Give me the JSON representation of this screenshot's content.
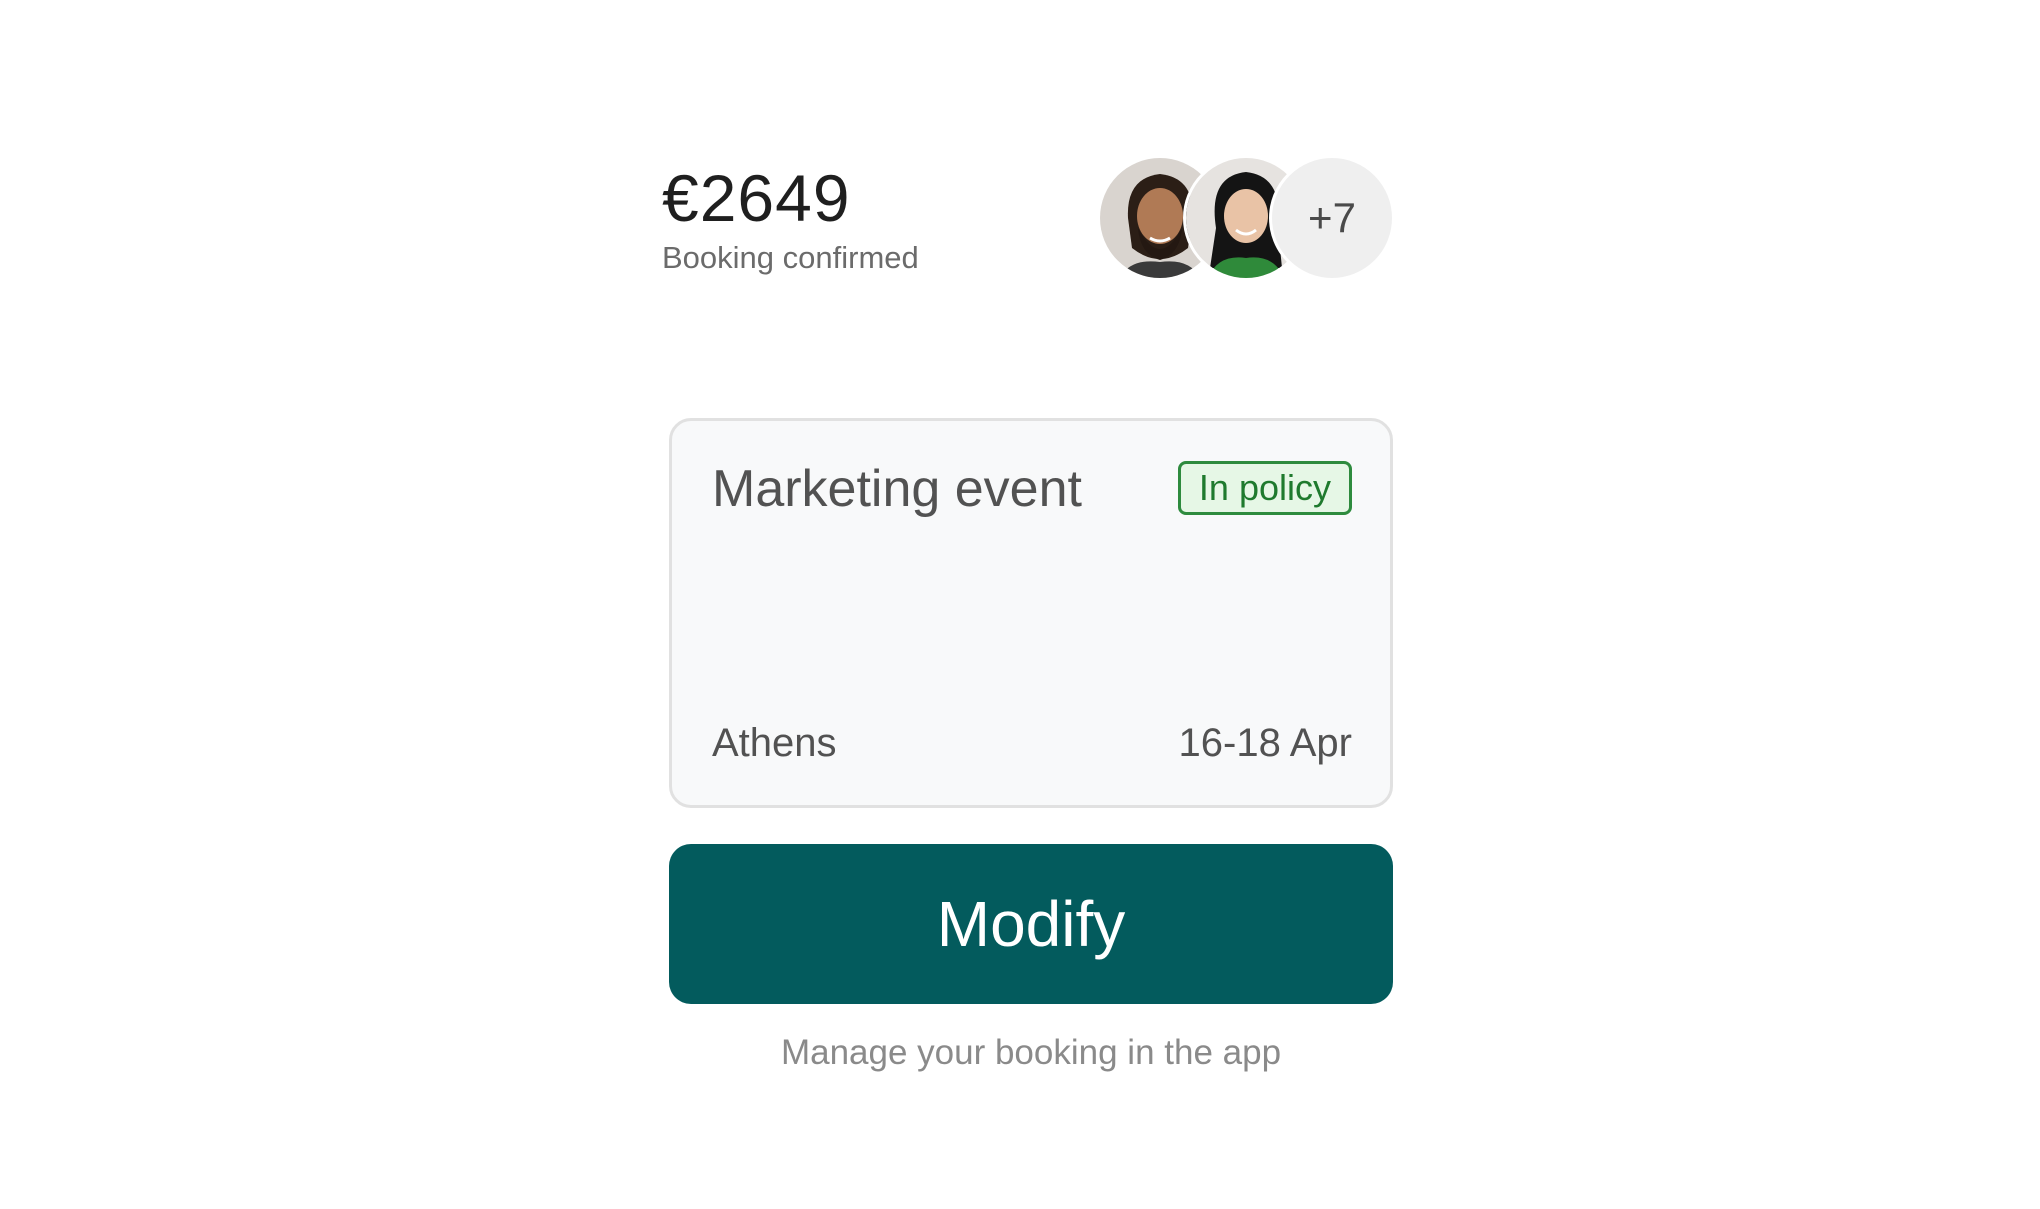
{
  "booking": {
    "price": "€2649",
    "status": "Booking confirmed"
  },
  "travelers": {
    "avatars": [
      {
        "name": "traveler-avatar-1",
        "icon": "person-photo"
      },
      {
        "name": "traveler-avatar-2",
        "icon": "person-photo"
      }
    ],
    "more_count": "+7"
  },
  "event_card": {
    "title": "Marketing event",
    "policy_badge": "In policy",
    "city": "Athens",
    "dates": "16-18 Apr"
  },
  "actions": {
    "modify_label": "Modify",
    "hint": "Manage your booking in the app"
  },
  "colors": {
    "primary": "#035b5d",
    "badge_border": "#2e8b3e",
    "badge_bg": "#e6f7e6",
    "badge_text": "#1f7a2e",
    "card_bg": "#f8f9fa"
  }
}
